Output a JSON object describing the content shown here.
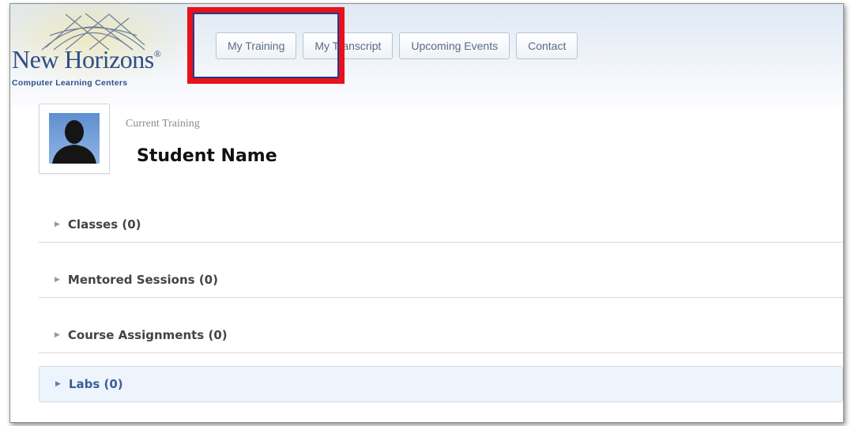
{
  "logo": {
    "brand": "New Horizons",
    "registered": "®",
    "tagline": "Computer Learning Centers"
  },
  "nav": {
    "tabs": [
      {
        "label": "My Training"
      },
      {
        "label": "My Transcript"
      },
      {
        "label": "Upcoming Events"
      },
      {
        "label": "Contact"
      }
    ]
  },
  "profile": {
    "section_label": "Current Training",
    "student_name": "Student Name"
  },
  "sections": [
    {
      "label": "Classes (0)"
    },
    {
      "label": "Mentored Sessions (0)"
    },
    {
      "label": "Course Assignments (0)"
    },
    {
      "label": "Labs (0)"
    }
  ],
  "colors": {
    "highlight_box": "#e8111c",
    "brand_blue": "#2d4f8a",
    "active_section_bg": "#eef4fb"
  },
  "icons": {
    "expand": "caret-right-icon",
    "avatar": "user-silhouette-icon"
  }
}
